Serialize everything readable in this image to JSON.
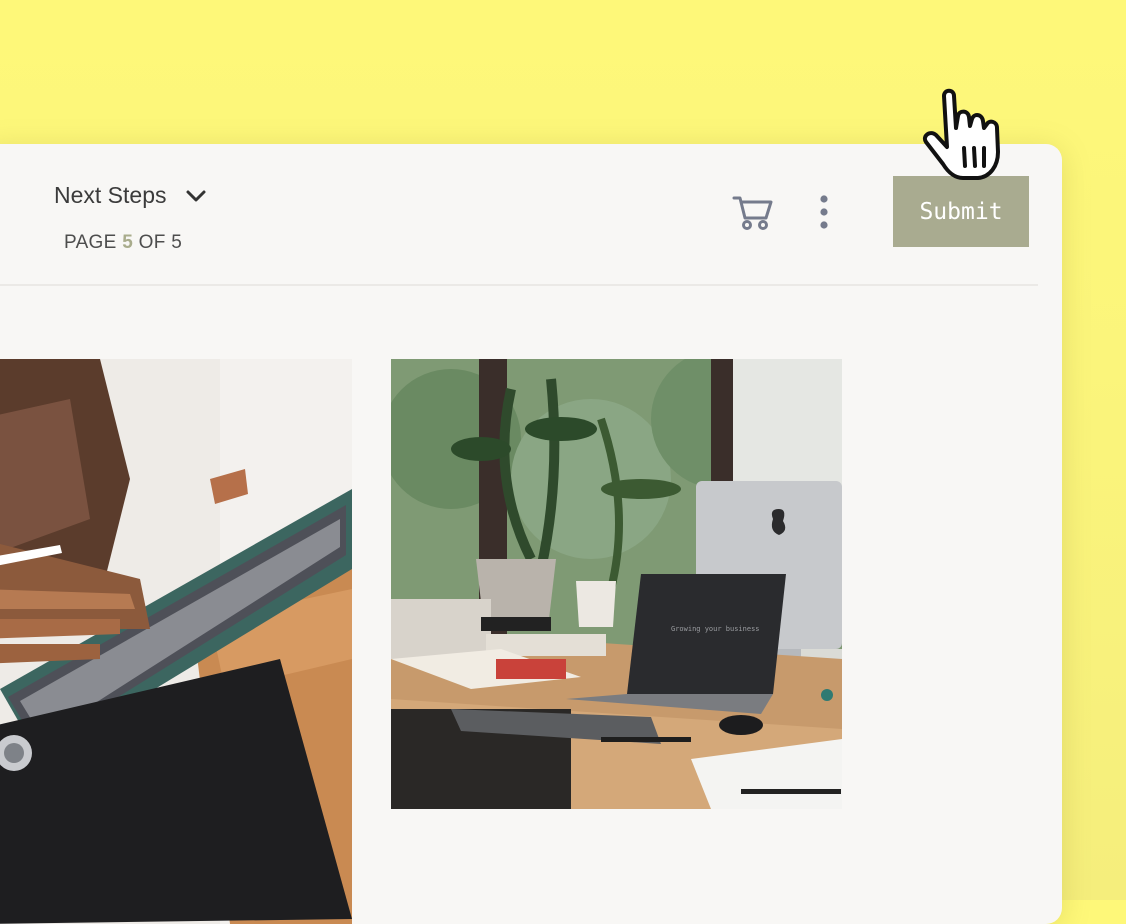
{
  "header": {
    "section_title": "Next Steps",
    "page_prefix": "PAGE",
    "page_current": "5",
    "page_of": "OF",
    "page_total": "5"
  },
  "actions": {
    "cart_icon": "cart-icon",
    "more_icon": "vertical-dots-icon",
    "submit_label": "Submit"
  },
  "gallery": {
    "images": [
      {
        "subject": "hands-holding-tablet-with-stylus"
      },
      {
        "subject": "desk-with-laptop-monitor-and-plants"
      }
    ],
    "laptop_screen_text": "Growing your business"
  },
  "colors": {
    "background": "#fef879",
    "card": "#f8f7f5",
    "accent": "#a9ab90",
    "page_number": "#a9ac8c"
  }
}
